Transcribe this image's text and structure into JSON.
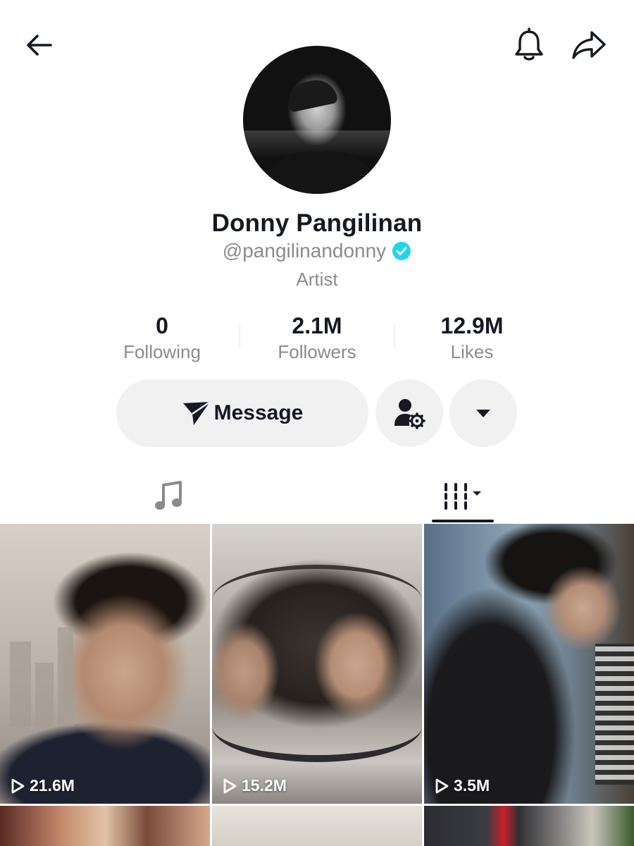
{
  "profile": {
    "name": "Donny Pangilinan",
    "handle": "@pangilinandonny",
    "bio": "Artist",
    "verified": true
  },
  "stats": {
    "following": {
      "value": "0",
      "label": "Following"
    },
    "followers": {
      "value": "2.1M",
      "label": "Followers"
    },
    "likes": {
      "value": "12.9M",
      "label": "Likes"
    }
  },
  "actions": {
    "message_label": "Message"
  },
  "tabs": {
    "music_icon": "music-note-icon",
    "videos_icon": "grid-filter-icon",
    "active": "videos"
  },
  "videos": [
    {
      "views": "21.6M"
    },
    {
      "views": "15.2M"
    },
    {
      "views": "3.5M"
    }
  ],
  "colors": {
    "text_primary": "#161823",
    "text_secondary": "#8a8b91",
    "button_bg": "#f1f1f2",
    "verified": "#20d5ec"
  }
}
